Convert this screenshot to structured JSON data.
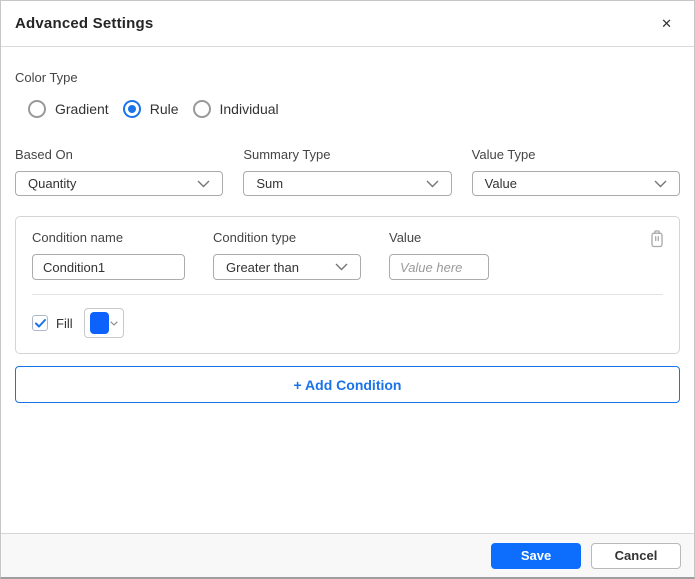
{
  "dialog": {
    "title": "Advanced Settings"
  },
  "icons": {
    "close": "✕",
    "chevron_down": "chevron-down",
    "trash": "trash-can",
    "check": "checkmark"
  },
  "color_type": {
    "label": "Color Type",
    "options": [
      {
        "label": "Gradient",
        "selected": false
      },
      {
        "label": "Rule",
        "selected": true
      },
      {
        "label": "Individual",
        "selected": false
      }
    ]
  },
  "selectors": {
    "based_on": {
      "label": "Based On",
      "value": "Quantity"
    },
    "summary_type": {
      "label": "Summary Type",
      "value": "Sum"
    },
    "value_type": {
      "label": "Value Type",
      "value": "Value"
    }
  },
  "condition": {
    "name": {
      "label": "Condition name",
      "value": "Condition1"
    },
    "type": {
      "label": "Condition type",
      "value": "Greater than"
    },
    "value": {
      "label": "Value",
      "placeholder": "Value here"
    },
    "fill": {
      "label": "Fill",
      "checked": true,
      "color": "#0d62fd"
    }
  },
  "add_condition": {
    "label": "+ Add Condition"
  },
  "footer": {
    "save": "Save",
    "cancel": "Cancel"
  },
  "colors": {
    "accent": "#1a73e8",
    "save_button": "#0d6efd",
    "fill_swatch": "#0d62fd",
    "footer_bg": "#f8f8f8"
  }
}
